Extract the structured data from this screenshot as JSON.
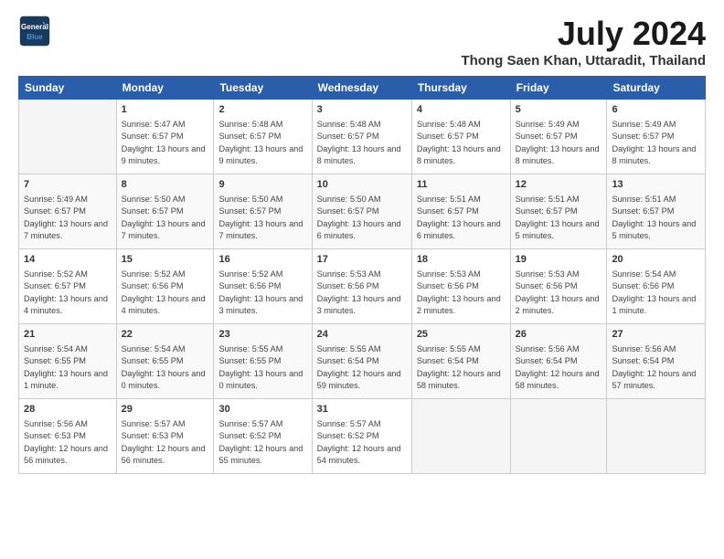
{
  "header": {
    "logo_line1": "General",
    "logo_line2": "Blue",
    "month_year": "July 2024",
    "location": "Thong Saen Khan, Uttaradit, Thailand"
  },
  "weekdays": [
    "Sunday",
    "Monday",
    "Tuesday",
    "Wednesday",
    "Thursday",
    "Friday",
    "Saturday"
  ],
  "weeks": [
    [
      {
        "day": "",
        "empty": true
      },
      {
        "day": "1",
        "sunrise": "Sunrise: 5:47 AM",
        "sunset": "Sunset: 6:57 PM",
        "daylight": "Daylight: 13 hours and 9 minutes."
      },
      {
        "day": "2",
        "sunrise": "Sunrise: 5:48 AM",
        "sunset": "Sunset: 6:57 PM",
        "daylight": "Daylight: 13 hours and 9 minutes."
      },
      {
        "day": "3",
        "sunrise": "Sunrise: 5:48 AM",
        "sunset": "Sunset: 6:57 PM",
        "daylight": "Daylight: 13 hours and 8 minutes."
      },
      {
        "day": "4",
        "sunrise": "Sunrise: 5:48 AM",
        "sunset": "Sunset: 6:57 PM",
        "daylight": "Daylight: 13 hours and 8 minutes."
      },
      {
        "day": "5",
        "sunrise": "Sunrise: 5:49 AM",
        "sunset": "Sunset: 6:57 PM",
        "daylight": "Daylight: 13 hours and 8 minutes."
      },
      {
        "day": "6",
        "sunrise": "Sunrise: 5:49 AM",
        "sunset": "Sunset: 6:57 PM",
        "daylight": "Daylight: 13 hours and 8 minutes."
      }
    ],
    [
      {
        "day": "7",
        "sunrise": "Sunrise: 5:49 AM",
        "sunset": "Sunset: 6:57 PM",
        "daylight": "Daylight: 13 hours and 7 minutes."
      },
      {
        "day": "8",
        "sunrise": "Sunrise: 5:50 AM",
        "sunset": "Sunset: 6:57 PM",
        "daylight": "Daylight: 13 hours and 7 minutes."
      },
      {
        "day": "9",
        "sunrise": "Sunrise: 5:50 AM",
        "sunset": "Sunset: 6:57 PM",
        "daylight": "Daylight: 13 hours and 7 minutes."
      },
      {
        "day": "10",
        "sunrise": "Sunrise: 5:50 AM",
        "sunset": "Sunset: 6:57 PM",
        "daylight": "Daylight: 13 hours and 6 minutes."
      },
      {
        "day": "11",
        "sunrise": "Sunrise: 5:51 AM",
        "sunset": "Sunset: 6:57 PM",
        "daylight": "Daylight: 13 hours and 6 minutes."
      },
      {
        "day": "12",
        "sunrise": "Sunrise: 5:51 AM",
        "sunset": "Sunset: 6:57 PM",
        "daylight": "Daylight: 13 hours and 5 minutes."
      },
      {
        "day": "13",
        "sunrise": "Sunrise: 5:51 AM",
        "sunset": "Sunset: 6:57 PM",
        "daylight": "Daylight: 13 hours and 5 minutes."
      }
    ],
    [
      {
        "day": "14",
        "sunrise": "Sunrise: 5:52 AM",
        "sunset": "Sunset: 6:57 PM",
        "daylight": "Daylight: 13 hours and 4 minutes."
      },
      {
        "day": "15",
        "sunrise": "Sunrise: 5:52 AM",
        "sunset": "Sunset: 6:56 PM",
        "daylight": "Daylight: 13 hours and 4 minutes."
      },
      {
        "day": "16",
        "sunrise": "Sunrise: 5:52 AM",
        "sunset": "Sunset: 6:56 PM",
        "daylight": "Daylight: 13 hours and 3 minutes."
      },
      {
        "day": "17",
        "sunrise": "Sunrise: 5:53 AM",
        "sunset": "Sunset: 6:56 PM",
        "daylight": "Daylight: 13 hours and 3 minutes."
      },
      {
        "day": "18",
        "sunrise": "Sunrise: 5:53 AM",
        "sunset": "Sunset: 6:56 PM",
        "daylight": "Daylight: 13 hours and 2 minutes."
      },
      {
        "day": "19",
        "sunrise": "Sunrise: 5:53 AM",
        "sunset": "Sunset: 6:56 PM",
        "daylight": "Daylight: 13 hours and 2 minutes."
      },
      {
        "day": "20",
        "sunrise": "Sunrise: 5:54 AM",
        "sunset": "Sunset: 6:56 PM",
        "daylight": "Daylight: 13 hours and 1 minute."
      }
    ],
    [
      {
        "day": "21",
        "sunrise": "Sunrise: 5:54 AM",
        "sunset": "Sunset: 6:55 PM",
        "daylight": "Daylight: 13 hours and 1 minute."
      },
      {
        "day": "22",
        "sunrise": "Sunrise: 5:54 AM",
        "sunset": "Sunset: 6:55 PM",
        "daylight": "Daylight: 13 hours and 0 minutes."
      },
      {
        "day": "23",
        "sunrise": "Sunrise: 5:55 AM",
        "sunset": "Sunset: 6:55 PM",
        "daylight": "Daylight: 13 hours and 0 minutes."
      },
      {
        "day": "24",
        "sunrise": "Sunrise: 5:55 AM",
        "sunset": "Sunset: 6:54 PM",
        "daylight": "Daylight: 12 hours and 59 minutes."
      },
      {
        "day": "25",
        "sunrise": "Sunrise: 5:55 AM",
        "sunset": "Sunset: 6:54 PM",
        "daylight": "Daylight: 12 hours and 58 minutes."
      },
      {
        "day": "26",
        "sunrise": "Sunrise: 5:56 AM",
        "sunset": "Sunset: 6:54 PM",
        "daylight": "Daylight: 12 hours and 58 minutes."
      },
      {
        "day": "27",
        "sunrise": "Sunrise: 5:56 AM",
        "sunset": "Sunset: 6:54 PM",
        "daylight": "Daylight: 12 hours and 57 minutes."
      }
    ],
    [
      {
        "day": "28",
        "sunrise": "Sunrise: 5:56 AM",
        "sunset": "Sunset: 6:53 PM",
        "daylight": "Daylight: 12 hours and 56 minutes."
      },
      {
        "day": "29",
        "sunrise": "Sunrise: 5:57 AM",
        "sunset": "Sunset: 6:53 PM",
        "daylight": "Daylight: 12 hours and 56 minutes."
      },
      {
        "day": "30",
        "sunrise": "Sunrise: 5:57 AM",
        "sunset": "Sunset: 6:52 PM",
        "daylight": "Daylight: 12 hours and 55 minutes."
      },
      {
        "day": "31",
        "sunrise": "Sunrise: 5:57 AM",
        "sunset": "Sunset: 6:52 PM",
        "daylight": "Daylight: 12 hours and 54 minutes."
      },
      {
        "day": "",
        "empty": true
      },
      {
        "day": "",
        "empty": true
      },
      {
        "day": "",
        "empty": true
      }
    ]
  ]
}
